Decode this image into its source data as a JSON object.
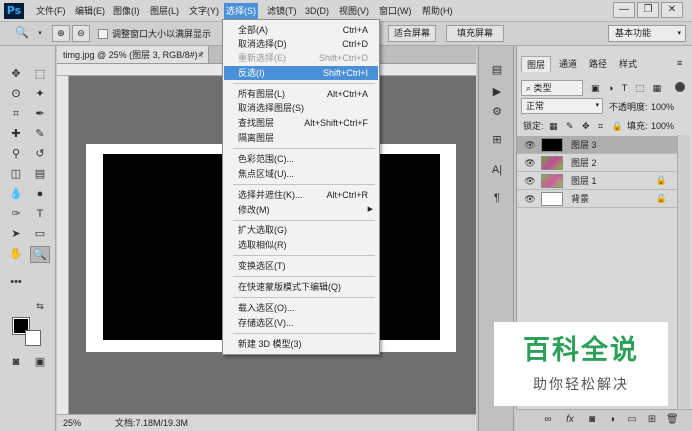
{
  "app": {
    "logo": "Ps"
  },
  "menubar": {
    "items": [
      "文件(F)",
      "编辑(E)",
      "图像(I)",
      "图层(L)",
      "文字(Y)",
      "选择(S)",
      "滤镜(T)",
      "3D(D)",
      "视图(V)",
      "窗口(W)",
      "帮助(H)"
    ],
    "active": "选择(S)",
    "controls": {
      "minimize": "—",
      "restore": "❐",
      "close": "✕"
    }
  },
  "optionsbar": {
    "checkbox_label": "调整窗口大小以满屏显示",
    "fit_screen": "适合屏幕",
    "fill_screen": "填充屏幕",
    "workspace": "基本功能"
  },
  "document": {
    "tab_title": "timg.jpg @ 25% (图层 3, RGB/8#) *",
    "tab_close": "×",
    "zoom": "25%",
    "doc_info": "文档:7.18M/19.3M"
  },
  "select_menu": {
    "items": [
      {
        "label": "全部(A)",
        "shortcut": "Ctrl+A",
        "disabled": false
      },
      {
        "label": "取消选择(D)",
        "shortcut": "Ctrl+D",
        "disabled": false
      },
      {
        "label": "重新选择(E)",
        "shortcut": "Shift+Ctrl+D",
        "disabled": true
      },
      {
        "label": "反选(I)",
        "shortcut": "Shift+Ctrl+I",
        "disabled": false,
        "highlighted": true
      },
      {
        "label": "所有图层(L)",
        "shortcut": "Alt+Ctrl+A",
        "disabled": false
      },
      {
        "label": "取消选择图层(S)",
        "shortcut": "",
        "disabled": false
      },
      {
        "label": "查找图层",
        "shortcut": "Alt+Shift+Ctrl+F",
        "disabled": false
      },
      {
        "label": "隔离图层",
        "shortcut": "",
        "disabled": false
      },
      {
        "label": "色彩范围(C)...",
        "shortcut": "",
        "disabled": false
      },
      {
        "label": "焦点区域(U)...",
        "shortcut": "",
        "disabled": false
      },
      {
        "label": "选择并遮住(K)...",
        "shortcut": "Alt+Ctrl+R",
        "disabled": false
      },
      {
        "label": "修改(M)",
        "shortcut": "",
        "disabled": false,
        "submenu": true
      },
      {
        "label": "扩大选取(G)",
        "shortcut": "",
        "disabled": false
      },
      {
        "label": "选取相似(R)",
        "shortcut": "",
        "disabled": false
      },
      {
        "label": "变换选区(T)",
        "shortcut": "",
        "disabled": false
      },
      {
        "label": "在快速蒙版模式下编辑(Q)",
        "shortcut": "",
        "disabled": false
      },
      {
        "label": "载入选区(O)...",
        "shortcut": "",
        "disabled": false
      },
      {
        "label": "存储选区(V)...",
        "shortcut": "",
        "disabled": false
      },
      {
        "label": "新建 3D 模型(3)",
        "shortcut": "",
        "disabled": false
      }
    ]
  },
  "layers_panel": {
    "tabs": [
      "图层",
      "通道",
      "路径",
      "样式"
    ],
    "active_tab": "图层",
    "filter_kind": "类型",
    "blend_mode": "正常",
    "opacity_label": "不透明度:",
    "opacity_value": "100%",
    "lock_label": "锁定:",
    "fill_label": "填充:",
    "fill_value": "100%",
    "layers": [
      {
        "name": "图层 3",
        "thumb": "#000000",
        "selected": true,
        "locked": false
      },
      {
        "name": "图层 2",
        "thumb": "#7aa84c",
        "selected": false,
        "locked": false
      },
      {
        "name": "图层 1",
        "thumb": "#8fb35a",
        "selected": false,
        "locked": true
      },
      {
        "name": "背景",
        "thumb": "#ffffff",
        "selected": false,
        "locked": true
      }
    ]
  },
  "watermark": {
    "title": "百科全说",
    "subtitle": "助你轻松解决"
  },
  "colors": {
    "accent": "#4a90d9",
    "watermark": "#2c9f58"
  }
}
